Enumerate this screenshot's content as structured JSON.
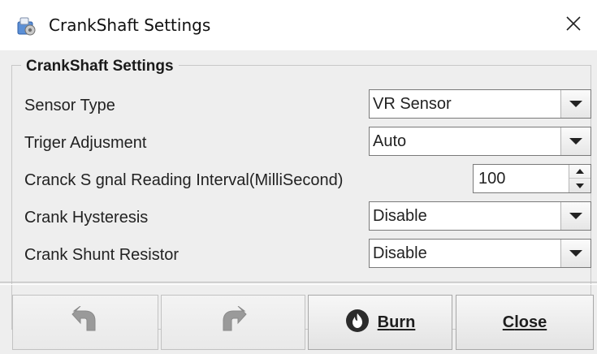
{
  "window": {
    "title": "CrankShaft Settings",
    "app_icon": "settings-app-icon",
    "close_icon": "close-icon"
  },
  "group": {
    "title": "CrankShaft Settings"
  },
  "fields": {
    "sensor_type": {
      "label": "Sensor Type",
      "value": "VR Sensor"
    },
    "trigger_adjustment": {
      "label": "Triger Adjusment",
      "value": "Auto"
    },
    "reading_interval": {
      "label": "Cranck S gnal Reading Interval(MilliSecond)",
      "value": "100"
    },
    "crank_hysteresis": {
      "label": "Crank Hysteresis",
      "value": "Disable"
    },
    "crank_shunt_resistor": {
      "label": "Crank Shunt Resistor",
      "value": "Disable"
    }
  },
  "buttons": {
    "undo_icon": "undo-arrow-icon",
    "redo_icon": "redo-arrow-icon",
    "burn": {
      "mnemonic": "B",
      "rest": "urn",
      "icon": "flame-icon"
    },
    "close": {
      "mnemonic": "C",
      "rest": "lose"
    }
  },
  "colors": {
    "burn_icon_bg": "#2b2b2b",
    "disabled_icon": "#9a9a9a"
  }
}
